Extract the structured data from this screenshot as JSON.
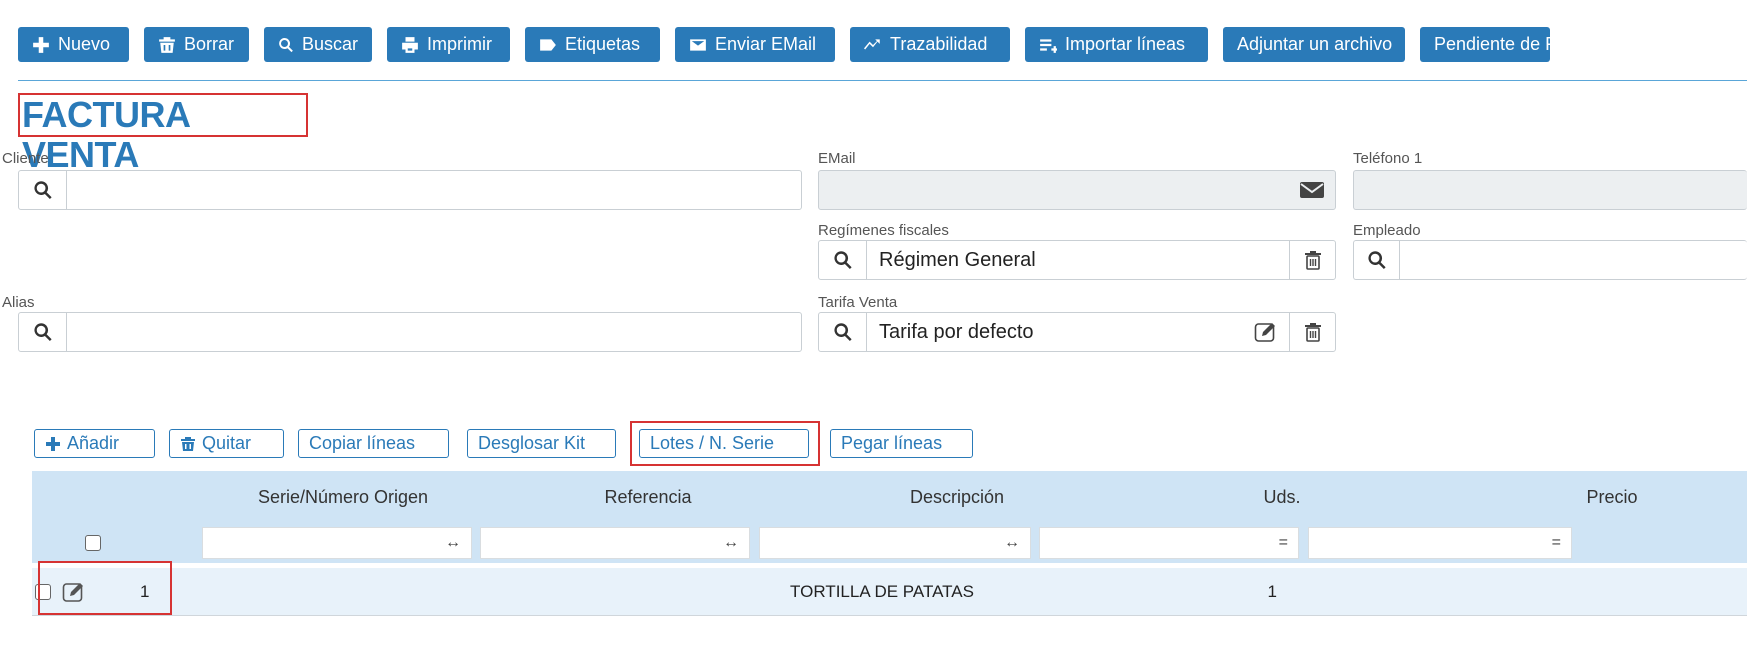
{
  "toolbar": {
    "buttons": [
      {
        "label": "Nuevo",
        "icon": "plus-icon"
      },
      {
        "label": "Borrar",
        "icon": "trash-icon"
      },
      {
        "label": "Buscar",
        "icon": "search-icon"
      },
      {
        "label": "Imprimir",
        "icon": "print-icon"
      },
      {
        "label": "Etiquetas",
        "icon": "tag-icon"
      },
      {
        "label": "Enviar EMail",
        "icon": "mail-icon"
      },
      {
        "label": "Trazabilidad",
        "icon": "trend-icon"
      },
      {
        "label": "Importar líneas",
        "icon": "import-icon"
      },
      {
        "label": "Adjuntar un archivo",
        "icon": ""
      },
      {
        "label": "Pendiente de F",
        "icon": ""
      }
    ]
  },
  "page": {
    "title": "FACTURA VENTA"
  },
  "form": {
    "cliente": {
      "label": "Cliente",
      "value": ""
    },
    "email": {
      "label": "EMail",
      "value": ""
    },
    "telefono": {
      "label": "Teléfono 1",
      "value": ""
    },
    "regimenes": {
      "label": "Regímenes fiscales",
      "value": "Régimen General"
    },
    "empleado": {
      "label": "Empleado",
      "value": ""
    },
    "alias": {
      "label": "Alias",
      "value": ""
    },
    "tarifa": {
      "label": "Tarifa Venta",
      "value": "Tarifa por defecto"
    }
  },
  "lines_toolbar": {
    "add": "Añadir",
    "remove": "Quitar",
    "copy": "Copiar líneas",
    "explode_kit": "Desglosar Kit",
    "lots": "Lotes / N. Serie",
    "paste": "Pegar líneas"
  },
  "grid": {
    "columns": [
      "Serie/Número Origen",
      "Referencia",
      "Descripción",
      "Uds.",
      "Precio"
    ],
    "filters": [
      "↔",
      "↔",
      "↔",
      "=",
      "="
    ],
    "rows": [
      {
        "num": "1",
        "serie": "",
        "referencia": "",
        "descripcion": "TORTILLA DE PATATAS",
        "uds": "1",
        "precio": ""
      }
    ]
  },
  "colors": {
    "accent": "#2a7ab8",
    "highlight": "#d63333",
    "grid_header": "#cfe4f5"
  }
}
